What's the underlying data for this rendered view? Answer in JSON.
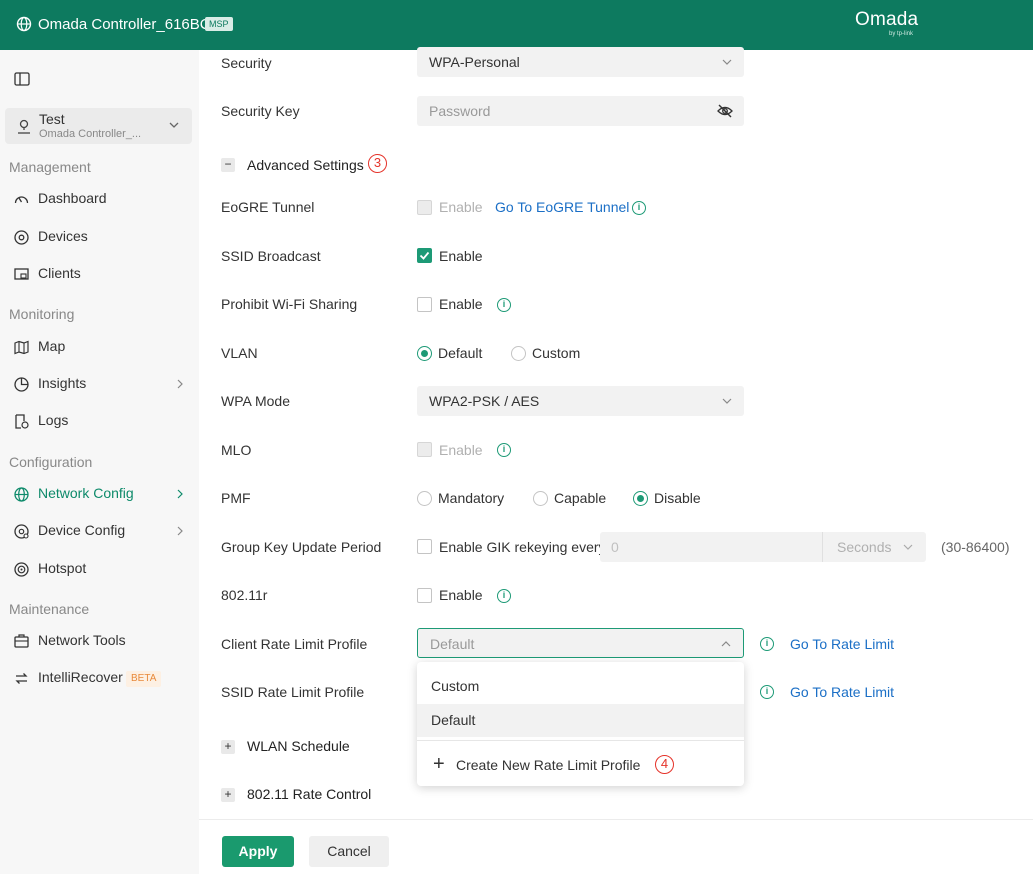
{
  "header": {
    "title": "Omada Controller_616BC1",
    "badge": "MSP",
    "brand": "Omada",
    "brand_sub": "by tp-link"
  },
  "sidebar": {
    "site": {
      "name": "Test",
      "sub": "Omada Controller_..."
    },
    "sections": {
      "management": "Management",
      "monitoring": "Monitoring",
      "configuration": "Configuration",
      "maintenance": "Maintenance"
    },
    "items": {
      "dashboard": "Dashboard",
      "devices": "Devices",
      "clients": "Clients",
      "map": "Map",
      "insights": "Insights",
      "logs": "Logs",
      "network_config": "Network Config",
      "device_config": "Device Config",
      "hotspot": "Hotspot",
      "network_tools": "Network Tools",
      "intellirecover": "IntelliRecover",
      "beta": "BETA"
    }
  },
  "form": {
    "security": {
      "label": "Security",
      "value": "WPA-Personal"
    },
    "security_key": {
      "label": "Security Key",
      "placeholder": "Password"
    },
    "advanced": {
      "label": "Advanced Settings",
      "marker": "3"
    },
    "eogre": {
      "label": "EoGRE Tunnel",
      "option": "Enable",
      "link": "Go To EoGRE Tunnel"
    },
    "ssid_broadcast": {
      "label": "SSID Broadcast",
      "option": "Enable",
      "checked": true
    },
    "prohibit_wifi": {
      "label": "Prohibit Wi-Fi Sharing",
      "option": "Enable"
    },
    "vlan": {
      "label": "VLAN",
      "opt1": "Default",
      "opt2": "Custom"
    },
    "wpa_mode": {
      "label": "WPA Mode",
      "value": "WPA2-PSK / AES"
    },
    "mlo": {
      "label": "MLO",
      "option": "Enable"
    },
    "pmf": {
      "label": "PMF",
      "opt1": "Mandatory",
      "opt2": "Capable",
      "opt3": "Disable"
    },
    "gik": {
      "label": "Group Key Update Period",
      "option": "Enable GIK rekeying every",
      "value": "0",
      "unit": "Seconds",
      "range": "(30-86400)"
    },
    "r80211": {
      "label": "802.11r",
      "option": "Enable"
    },
    "client_rate": {
      "label": "Client Rate Limit Profile",
      "value": "Default",
      "link": "Go To Rate Limit"
    },
    "ssid_rate": {
      "label": "SSID Rate Limit Profile",
      "link": "Go To Rate Limit"
    },
    "wlan_schedule": {
      "label": "WLAN Schedule"
    },
    "rate_control": {
      "label": "802.11 Rate Control"
    }
  },
  "dropdown": {
    "options": [
      "Custom",
      "Default"
    ],
    "selected": "Default",
    "create": "Create New Rate Limit Profile",
    "marker": "4"
  },
  "footer": {
    "apply": "Apply",
    "cancel": "Cancel"
  },
  "colors": {
    "header": "#0d7a5f",
    "accent": "#1d9a76",
    "link": "#1b6fc6",
    "marker": "#e5332a"
  }
}
